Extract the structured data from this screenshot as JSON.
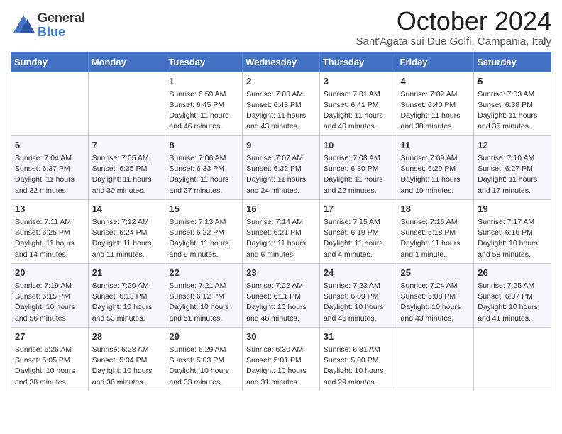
{
  "logo": {
    "general": "General",
    "blue": "Blue"
  },
  "title": "October 2024",
  "location": "Sant'Agata sui Due Golfi, Campania, Italy",
  "days_of_week": [
    "Sunday",
    "Monday",
    "Tuesday",
    "Wednesday",
    "Thursday",
    "Friday",
    "Saturday"
  ],
  "weeks": [
    [
      {
        "day": "",
        "sunrise": "",
        "sunset": "",
        "daylight": ""
      },
      {
        "day": "",
        "sunrise": "",
        "sunset": "",
        "daylight": ""
      },
      {
        "day": "1",
        "sunrise": "Sunrise: 6:59 AM",
        "sunset": "Sunset: 6:45 PM",
        "daylight": "Daylight: 11 hours and 46 minutes."
      },
      {
        "day": "2",
        "sunrise": "Sunrise: 7:00 AM",
        "sunset": "Sunset: 6:43 PM",
        "daylight": "Daylight: 11 hours and 43 minutes."
      },
      {
        "day": "3",
        "sunrise": "Sunrise: 7:01 AM",
        "sunset": "Sunset: 6:41 PM",
        "daylight": "Daylight: 11 hours and 40 minutes."
      },
      {
        "day": "4",
        "sunrise": "Sunrise: 7:02 AM",
        "sunset": "Sunset: 6:40 PM",
        "daylight": "Daylight: 11 hours and 38 minutes."
      },
      {
        "day": "5",
        "sunrise": "Sunrise: 7:03 AM",
        "sunset": "Sunset: 6:38 PM",
        "daylight": "Daylight: 11 hours and 35 minutes."
      }
    ],
    [
      {
        "day": "6",
        "sunrise": "Sunrise: 7:04 AM",
        "sunset": "Sunset: 6:37 PM",
        "daylight": "Daylight: 11 hours and 32 minutes."
      },
      {
        "day": "7",
        "sunrise": "Sunrise: 7:05 AM",
        "sunset": "Sunset: 6:35 PM",
        "daylight": "Daylight: 11 hours and 30 minutes."
      },
      {
        "day": "8",
        "sunrise": "Sunrise: 7:06 AM",
        "sunset": "Sunset: 6:33 PM",
        "daylight": "Daylight: 11 hours and 27 minutes."
      },
      {
        "day": "9",
        "sunrise": "Sunrise: 7:07 AM",
        "sunset": "Sunset: 6:32 PM",
        "daylight": "Daylight: 11 hours and 24 minutes."
      },
      {
        "day": "10",
        "sunrise": "Sunrise: 7:08 AM",
        "sunset": "Sunset: 6:30 PM",
        "daylight": "Daylight: 11 hours and 22 minutes."
      },
      {
        "day": "11",
        "sunrise": "Sunrise: 7:09 AM",
        "sunset": "Sunset: 6:29 PM",
        "daylight": "Daylight: 11 hours and 19 minutes."
      },
      {
        "day": "12",
        "sunrise": "Sunrise: 7:10 AM",
        "sunset": "Sunset: 6:27 PM",
        "daylight": "Daylight: 11 hours and 17 minutes."
      }
    ],
    [
      {
        "day": "13",
        "sunrise": "Sunrise: 7:11 AM",
        "sunset": "Sunset: 6:25 PM",
        "daylight": "Daylight: 11 hours and 14 minutes."
      },
      {
        "day": "14",
        "sunrise": "Sunrise: 7:12 AM",
        "sunset": "Sunset: 6:24 PM",
        "daylight": "Daylight: 11 hours and 11 minutes."
      },
      {
        "day": "15",
        "sunrise": "Sunrise: 7:13 AM",
        "sunset": "Sunset: 6:22 PM",
        "daylight": "Daylight: 11 hours and 9 minutes."
      },
      {
        "day": "16",
        "sunrise": "Sunrise: 7:14 AM",
        "sunset": "Sunset: 6:21 PM",
        "daylight": "Daylight: 11 hours and 6 minutes."
      },
      {
        "day": "17",
        "sunrise": "Sunrise: 7:15 AM",
        "sunset": "Sunset: 6:19 PM",
        "daylight": "Daylight: 11 hours and 4 minutes."
      },
      {
        "day": "18",
        "sunrise": "Sunrise: 7:16 AM",
        "sunset": "Sunset: 6:18 PM",
        "daylight": "Daylight: 11 hours and 1 minute."
      },
      {
        "day": "19",
        "sunrise": "Sunrise: 7:17 AM",
        "sunset": "Sunset: 6:16 PM",
        "daylight": "Daylight: 10 hours and 58 minutes."
      }
    ],
    [
      {
        "day": "20",
        "sunrise": "Sunrise: 7:19 AM",
        "sunset": "Sunset: 6:15 PM",
        "daylight": "Daylight: 10 hours and 56 minutes."
      },
      {
        "day": "21",
        "sunrise": "Sunrise: 7:20 AM",
        "sunset": "Sunset: 6:13 PM",
        "daylight": "Daylight: 10 hours and 53 minutes."
      },
      {
        "day": "22",
        "sunrise": "Sunrise: 7:21 AM",
        "sunset": "Sunset: 6:12 PM",
        "daylight": "Daylight: 10 hours and 51 minutes."
      },
      {
        "day": "23",
        "sunrise": "Sunrise: 7:22 AM",
        "sunset": "Sunset: 6:11 PM",
        "daylight": "Daylight: 10 hours and 48 minutes."
      },
      {
        "day": "24",
        "sunrise": "Sunrise: 7:23 AM",
        "sunset": "Sunset: 6:09 PM",
        "daylight": "Daylight: 10 hours and 46 minutes."
      },
      {
        "day": "25",
        "sunrise": "Sunrise: 7:24 AM",
        "sunset": "Sunset: 6:08 PM",
        "daylight": "Daylight: 10 hours and 43 minutes."
      },
      {
        "day": "26",
        "sunrise": "Sunrise: 7:25 AM",
        "sunset": "Sunset: 6:07 PM",
        "daylight": "Daylight: 10 hours and 41 minutes."
      }
    ],
    [
      {
        "day": "27",
        "sunrise": "Sunrise: 6:26 AM",
        "sunset": "Sunset: 5:05 PM",
        "daylight": "Daylight: 10 hours and 38 minutes."
      },
      {
        "day": "28",
        "sunrise": "Sunrise: 6:28 AM",
        "sunset": "Sunset: 5:04 PM",
        "daylight": "Daylight: 10 hours and 36 minutes."
      },
      {
        "day": "29",
        "sunrise": "Sunrise: 6:29 AM",
        "sunset": "Sunset: 5:03 PM",
        "daylight": "Daylight: 10 hours and 33 minutes."
      },
      {
        "day": "30",
        "sunrise": "Sunrise: 6:30 AM",
        "sunset": "Sunset: 5:01 PM",
        "daylight": "Daylight: 10 hours and 31 minutes."
      },
      {
        "day": "31",
        "sunrise": "Sunrise: 6:31 AM",
        "sunset": "Sunset: 5:00 PM",
        "daylight": "Daylight: 10 hours and 29 minutes."
      },
      {
        "day": "",
        "sunrise": "",
        "sunset": "",
        "daylight": ""
      },
      {
        "day": "",
        "sunrise": "",
        "sunset": "",
        "daylight": ""
      }
    ]
  ]
}
